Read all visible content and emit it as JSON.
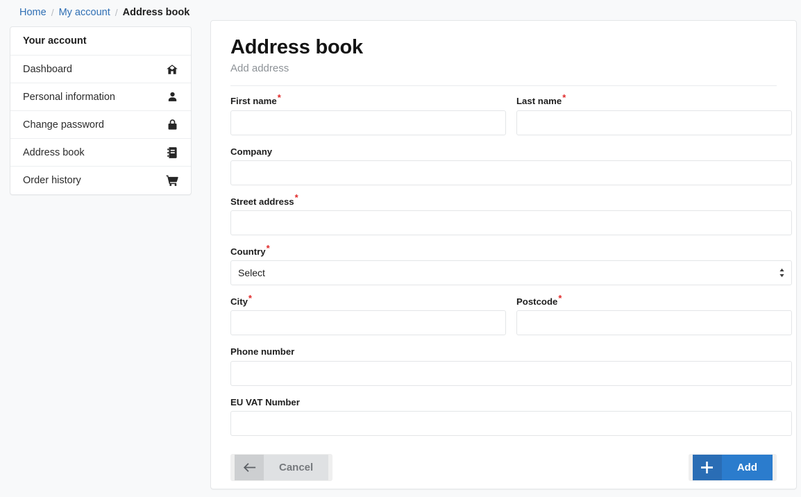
{
  "breadcrumb": {
    "items": [
      {
        "label": "Home",
        "current": false
      },
      {
        "label": "My account",
        "current": false
      },
      {
        "label": "Address book",
        "current": true
      }
    ],
    "separator": "/"
  },
  "sidebar": {
    "header": "Your account",
    "items": [
      {
        "label": "Dashboard",
        "icon": "home-icon"
      },
      {
        "label": "Personal information",
        "icon": "user-icon"
      },
      {
        "label": "Change password",
        "icon": "lock-icon"
      },
      {
        "label": "Address book",
        "icon": "address-book-icon"
      },
      {
        "label": "Order history",
        "icon": "shopping-cart-icon"
      }
    ]
  },
  "main": {
    "title": "Address book",
    "subtitle": "Add address",
    "required_marker": "*",
    "form": {
      "first_name": {
        "label": "First name",
        "value": "",
        "placeholder": "",
        "required": true
      },
      "last_name": {
        "label": "Last name",
        "value": "",
        "placeholder": "",
        "required": true
      },
      "company": {
        "label": "Company",
        "value": "",
        "placeholder": "",
        "required": false
      },
      "street_address": {
        "label": "Street address",
        "value": "",
        "placeholder": "",
        "required": true
      },
      "country": {
        "label": "Country",
        "selected": "Select",
        "options": [
          "Select"
        ],
        "required": true
      },
      "city": {
        "label": "City",
        "value": "",
        "placeholder": "",
        "required": true
      },
      "postcode": {
        "label": "Postcode",
        "value": "",
        "placeholder": "",
        "required": true
      },
      "phone_number": {
        "label": "Phone number",
        "value": "",
        "placeholder": "",
        "required": false
      },
      "eu_vat_number": {
        "label": "EU VAT Number",
        "value": "",
        "placeholder": "",
        "required": false
      }
    },
    "buttons": {
      "cancel": {
        "label": "Cancel",
        "icon": "arrow-left-icon"
      },
      "add": {
        "label": "Add",
        "icon": "plus-icon"
      }
    }
  },
  "colors": {
    "link": "#2f6fb4",
    "primary": "#2b7ccd",
    "primary_dark": "#2a6db5",
    "required": "#e02a2a",
    "page_background": "#f8f9fa",
    "card_background": "#ffffff",
    "border": "#e4e6e8",
    "muted_text": "#8d9297"
  }
}
